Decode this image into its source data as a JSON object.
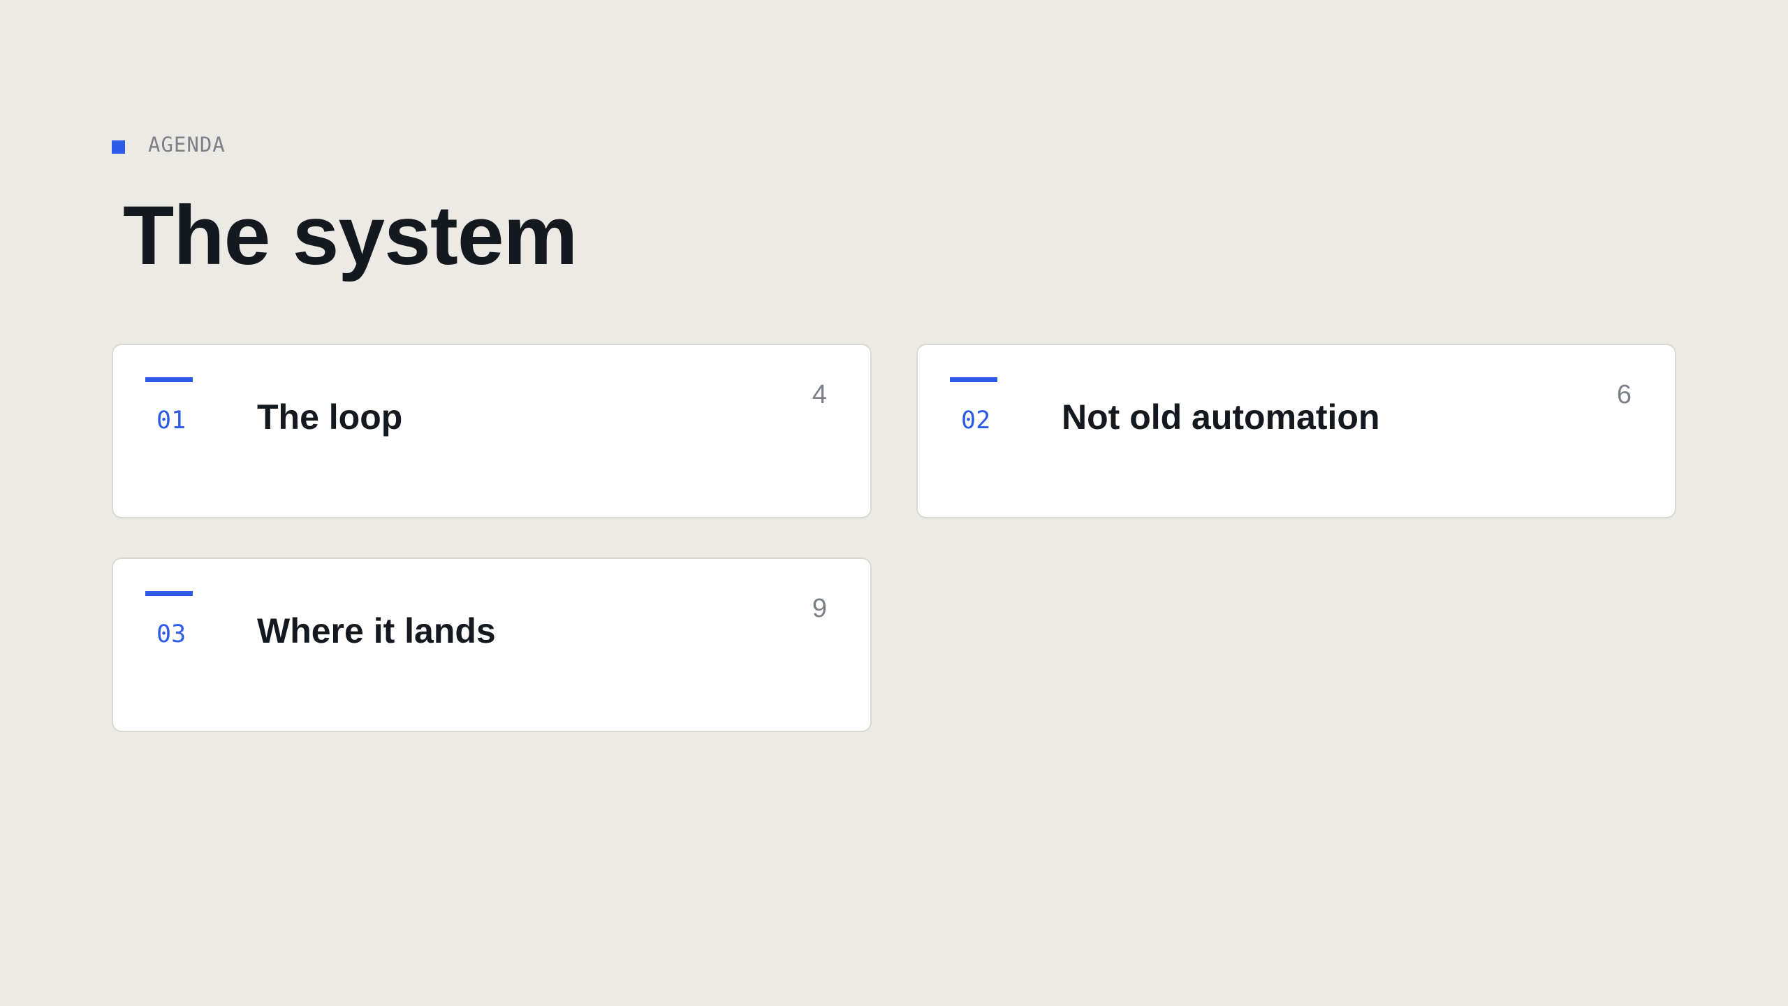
{
  "theme": {
    "accent": "#2d5ae6",
    "background": "#ebeae5",
    "card_background": "#ffffff",
    "text": "#14181f",
    "muted": "#7b7f88"
  },
  "header": {
    "eyebrow": "AGENDA",
    "title": "The system"
  },
  "agenda": {
    "items": [
      {
        "index": "01",
        "label": "The loop",
        "page": "4"
      },
      {
        "index": "02",
        "label": "Not old automation",
        "page": "6"
      },
      {
        "index": "03",
        "label": "Where it lands",
        "page": "9"
      }
    ]
  }
}
